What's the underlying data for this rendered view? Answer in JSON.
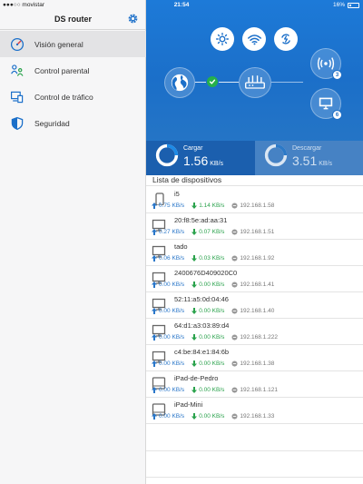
{
  "status_bar": {
    "carrier": "●●●○○ movistar",
    "time": "21:54",
    "battery": "16%"
  },
  "sidebar": {
    "title": "DS router",
    "items": [
      {
        "label": "Visión general",
        "icon": "gauge-icon",
        "active": true
      },
      {
        "label": "Control parental",
        "icon": "family-icon",
        "active": false
      },
      {
        "label": "Control de tráfico",
        "icon": "devices-icon",
        "active": false
      },
      {
        "label": "Seguridad",
        "icon": "shield-icon",
        "active": false
      }
    ]
  },
  "overview": {
    "wireless_clients": "3",
    "wired_clients": "6",
    "upload": {
      "label": "Cargar",
      "value": "1.56",
      "unit": "KB/s"
    },
    "download": {
      "label": "Descargar",
      "value": "3.51",
      "unit": "KB/s"
    }
  },
  "device_list": {
    "title": "Lista de dispositivos",
    "devices": [
      {
        "name": "i5",
        "icon": "phone-icon",
        "up": "0.75 KB/s",
        "down": "1.14 KB/s",
        "ip": "192.168.1.58"
      },
      {
        "name": "20:f8:5e:ad:aa:31",
        "icon": "computer-icon",
        "up": "0.27 KB/s",
        "down": "0.07 KB/s",
        "ip": "192.168.1.51"
      },
      {
        "name": "tado",
        "icon": "computer-icon",
        "up": "0.06 KB/s",
        "down": "0.03 KB/s",
        "ip": "192.168.1.92"
      },
      {
        "name": "2400676D409020C0",
        "icon": "computer-icon",
        "up": "0.00 KB/s",
        "down": "0.00 KB/s",
        "ip": "192.168.1.41"
      },
      {
        "name": "52:11:a5:0d:04:46",
        "icon": "computer-icon",
        "up": "0.00 KB/s",
        "down": "0.00 KB/s",
        "ip": "192.168.1.40"
      },
      {
        "name": "64:d1:a3:03:89:d4",
        "icon": "computer-icon",
        "up": "0.00 KB/s",
        "down": "0.00 KB/s",
        "ip": "192.168.1.222"
      },
      {
        "name": "c4:be:84:e1:84:6b",
        "icon": "computer-icon",
        "up": "0.00 KB/s",
        "down": "0.00 KB/s",
        "ip": "192.168.1.38"
      },
      {
        "name": "iPad-de-Pedro",
        "icon": "tablet-icon",
        "up": "0.00 KB/s",
        "down": "0.00 KB/s",
        "ip": "192.168.1.121"
      },
      {
        "name": "iPad-Mini",
        "icon": "tablet-icon",
        "up": "0.00 KB/s",
        "down": "0.00 KB/s",
        "ip": "192.168.1.33"
      }
    ]
  },
  "colors": {
    "accent": "#1b6fc9",
    "upload": "#2a77c9",
    "download": "#2aa24c",
    "status_ok": "#25b04a"
  }
}
